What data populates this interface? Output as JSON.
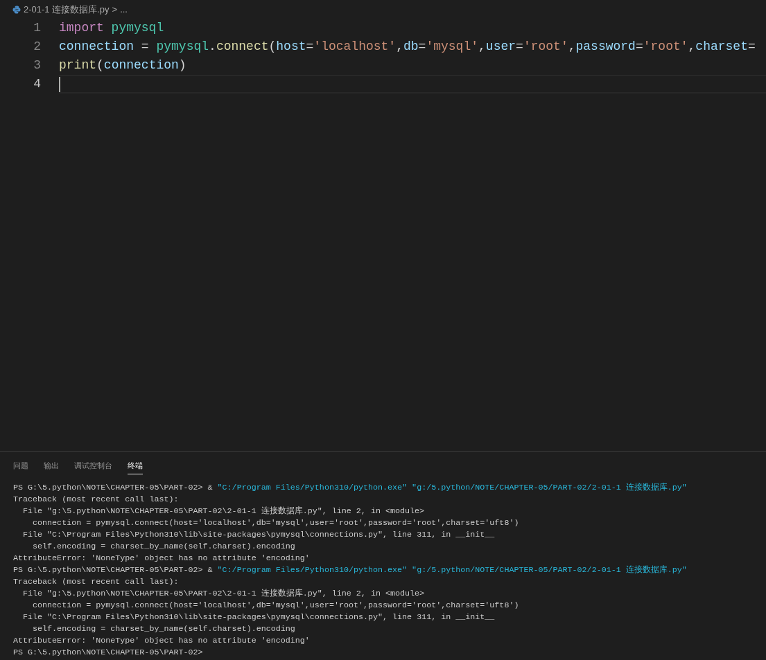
{
  "breadcrumb": {
    "file": "2-01-1 连接数据库.py",
    "separator": ">",
    "rest": "..."
  },
  "editor": {
    "lines": [
      {
        "number": "1",
        "current": false,
        "tokens": [
          {
            "kind": "keyword",
            "text": "import"
          },
          {
            "kind": "module",
            "text": "pymysql",
            "space_before": true
          }
        ]
      },
      {
        "number": "2",
        "current": false,
        "tokens": [
          {
            "kind": "variable",
            "text": "connection"
          },
          {
            "kind": "plain",
            "text": " = "
          },
          {
            "kind": "module",
            "text": "pymysql"
          },
          {
            "kind": "plain",
            "text": "."
          },
          {
            "kind": "function",
            "text": "connect"
          },
          {
            "kind": "plain",
            "text": "("
          },
          {
            "kind": "variable",
            "text": "host"
          },
          {
            "kind": "plain",
            "text": "="
          },
          {
            "kind": "string",
            "text": "'localhost'"
          },
          {
            "kind": "plain",
            "text": ","
          },
          {
            "kind": "variable",
            "text": "db"
          },
          {
            "kind": "plain",
            "text": "="
          },
          {
            "kind": "string",
            "text": "'mysql'"
          },
          {
            "kind": "plain",
            "text": ","
          },
          {
            "kind": "variable",
            "text": "user"
          },
          {
            "kind": "plain",
            "text": "="
          },
          {
            "kind": "string",
            "text": "'root'"
          },
          {
            "kind": "plain",
            "text": ","
          },
          {
            "kind": "variable",
            "text": "password"
          },
          {
            "kind": "plain",
            "text": "="
          },
          {
            "kind": "string",
            "text": "'root'"
          },
          {
            "kind": "plain",
            "text": ","
          },
          {
            "kind": "variable",
            "text": "charset"
          },
          {
            "kind": "plain",
            "text": "="
          }
        ]
      },
      {
        "number": "3",
        "current": false,
        "tokens": [
          {
            "kind": "function",
            "text": "print"
          },
          {
            "kind": "plain",
            "text": "("
          },
          {
            "kind": "variable",
            "text": "connection"
          },
          {
            "kind": "plain",
            "text": ")"
          }
        ]
      },
      {
        "number": "4",
        "current": true
      }
    ]
  },
  "panel": {
    "tabs": [
      {
        "label": "问题",
        "selected": false
      },
      {
        "label": "输出",
        "selected": false
      },
      {
        "label": "调试控制台",
        "selected": false
      },
      {
        "label": "终端",
        "selected": true
      }
    ]
  },
  "terminal": {
    "lines": [
      [
        {
          "kind": "plain",
          "text": "PS G:\\5.python\\NOTE\\CHAPTER-05\\PART-02> & "
        },
        {
          "kind": "string",
          "text": "\"C:/Program Files/Python310/python.exe\" \"g:/5.python/NOTE/CHAPTER-05/PART-02/2-01-1 连接数据库.py\""
        }
      ],
      [
        {
          "kind": "plain",
          "text": "Traceback (most recent call last):"
        }
      ],
      [
        {
          "kind": "plain",
          "text": "  File \"g:\\5.python\\NOTE\\CHAPTER-05\\PART-02\\2-01-1 连接数据库.py\", line 2, in <module>"
        }
      ],
      [
        {
          "kind": "plain",
          "text": "    connection = pymysql.connect(host='localhost',db='mysql',user='root',password='root',charset='uft8')"
        }
      ],
      [
        {
          "kind": "plain",
          "text": "  File \"C:\\Program Files\\Python310\\lib\\site-packages\\pymysql\\connections.py\", line 311, in __init__"
        }
      ],
      [
        {
          "kind": "plain",
          "text": "    self.encoding = charset_by_name(self.charset).encoding"
        }
      ],
      [
        {
          "kind": "plain",
          "text": "AttributeError: 'NoneType' object has no attribute 'encoding'"
        }
      ],
      [
        {
          "kind": "plain",
          "text": "PS G:\\5.python\\NOTE\\CHAPTER-05\\PART-02> & "
        },
        {
          "kind": "string",
          "text": "\"C:/Program Files/Python310/python.exe\" \"g:/5.python/NOTE/CHAPTER-05/PART-02/2-01-1 连接数据库.py\""
        }
      ],
      [
        {
          "kind": "plain",
          "text": "Traceback (most recent call last):"
        }
      ],
      [
        {
          "kind": "plain",
          "text": "  File \"g:\\5.python\\NOTE\\CHAPTER-05\\PART-02\\2-01-1 连接数据库.py\", line 2, in <module>"
        }
      ],
      [
        {
          "kind": "plain",
          "text": "    connection = pymysql.connect(host='localhost',db='mysql',user='root',password='root',charset='uft8')"
        }
      ],
      [
        {
          "kind": "plain",
          "text": "  File \"C:\\Program Files\\Python310\\lib\\site-packages\\pymysql\\connections.py\", line 311, in __init__"
        }
      ],
      [
        {
          "kind": "plain",
          "text": "    self.encoding = charset_by_name(self.charset).encoding"
        }
      ],
      [
        {
          "kind": "plain",
          "text": "AttributeError: 'NoneType' object has no attribute 'encoding'"
        }
      ],
      [
        {
          "kind": "plain",
          "text": "PS G:\\5.python\\NOTE\\CHAPTER-05\\PART-02>"
        }
      ]
    ]
  }
}
